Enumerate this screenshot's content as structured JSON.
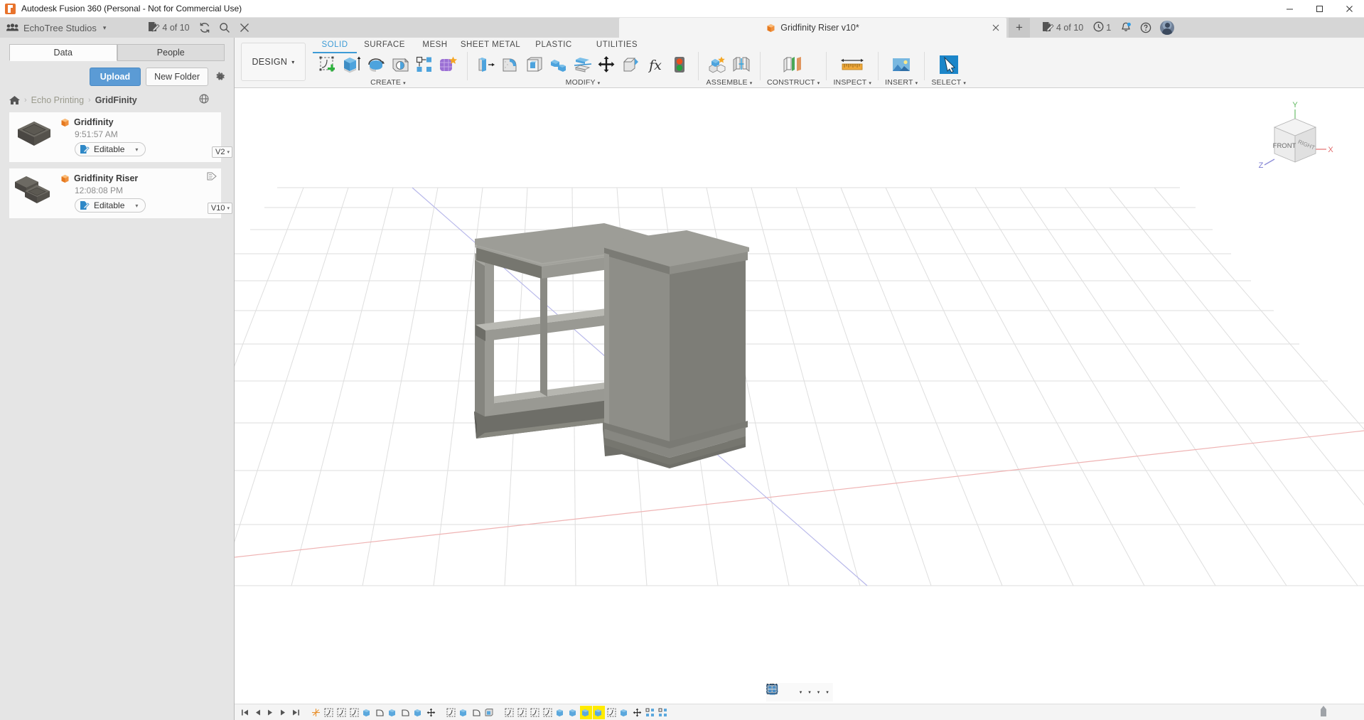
{
  "window": {
    "title": "Autodesk Fusion 360 (Personal - Not for Commercial Use)",
    "app_icon": "fusion-logo-icon",
    "minimize": "–",
    "maximize": "☐",
    "close": "✕"
  },
  "appbar": {
    "grid_icon": "app-grid-icon",
    "team_name": "EchoTree Studios",
    "team_caret": "▾",
    "jobs_icon": "job-status-icon",
    "jobs_count": "4 of 10",
    "refresh_icon": "refresh-icon",
    "search_icon": "search-icon",
    "close_icon": "close-panel-icon"
  },
  "doctab": {
    "cube_icon": "fusion-document-icon",
    "title": "Gridfinity Riser v10*",
    "close_icon": "close-tab-icon",
    "new_tab_icon": "+"
  },
  "topright": {
    "jobs_icon": "job-status-icon",
    "jobs_count": "4 of 10",
    "clock_icon": "recent-activity-icon",
    "clock_count": "1",
    "bell_icon": "notifications-icon",
    "help_icon": "help-icon",
    "avatar": "user-avatar"
  },
  "leftpanel": {
    "tabs": [
      {
        "label": "Data",
        "active": true
      },
      {
        "label": "People",
        "active": false
      }
    ],
    "upload_label": "Upload",
    "new_folder_label": "New Folder",
    "gear_icon": "settings-gear-icon",
    "breadcrumb": {
      "home_icon": "home-icon",
      "sep": "›",
      "items": [
        "Echo Printing",
        "GridFinity"
      ],
      "globe_icon": "globe-icon"
    },
    "files": [
      {
        "thumb": "gridfinity-bin-thumbnail",
        "cube_icon": "fusion-design-icon",
        "name": "Gridfinity",
        "time": "9:51:57 AM",
        "status_icon": "editable-pencil-icon",
        "status": "Editable",
        "status_caret": "▾",
        "version": "V2",
        "version_caret": "▾",
        "tagged": false
      },
      {
        "thumb": "gridfinity-riser-thumbnail",
        "cube_icon": "fusion-design-icon",
        "name": "Gridfinity Riser",
        "time": "12:08:08 PM",
        "status_icon": "editable-pencil-icon",
        "status": "Editable",
        "status_caret": "▾",
        "version": "V10",
        "version_caret": "▾",
        "tagged": true
      }
    ]
  },
  "ribbon": {
    "workspace_label": "DESIGN",
    "workspace_caret": "▾",
    "tabs": [
      {
        "label": "SOLID",
        "active": true
      },
      {
        "label": "SURFACE",
        "active": false
      },
      {
        "label": "MESH",
        "active": false
      },
      {
        "label": "SHEET METAL",
        "active": false
      },
      {
        "label": "PLASTIC",
        "active": false
      },
      {
        "label": "UTILITIES",
        "active": false
      }
    ],
    "groups": [
      {
        "label": "CREATE",
        "caret": "▾",
        "buttons": [
          "create-sketch-icon",
          "extrude-icon",
          "revolve-icon",
          "hole-icon",
          "rectangular-pattern-icon",
          "create-form-icon"
        ]
      },
      {
        "label": "MODIFY",
        "caret": "▾",
        "buttons": [
          "press-pull-icon",
          "fillet-icon",
          "shell-icon",
          "combine-icon",
          "split-body-icon",
          "move-copy-icon",
          "align-icon",
          "change-parameters-icon",
          "compute-all-icon"
        ]
      },
      {
        "label": "ASSEMBLE",
        "caret": "▾",
        "buttons": [
          "new-component-icon",
          "joint-icon"
        ]
      },
      {
        "label": "CONSTRUCT",
        "caret": "▾",
        "buttons": [
          "offset-plane-icon"
        ]
      },
      {
        "label": "INSPECT",
        "caret": "▾",
        "buttons": [
          "measure-icon"
        ]
      },
      {
        "label": "INSERT",
        "caret": "▾",
        "buttons": [
          "insert-mcmaster-icon"
        ]
      },
      {
        "label": "SELECT",
        "caret": "▾",
        "buttons": [
          "select-icon"
        ]
      }
    ]
  },
  "viewcube": {
    "front_label": "FRONT",
    "right_label": "RIGHT",
    "axis_x": "X",
    "axis_y": "Y",
    "axis_z": "Z",
    "axis_x_color": "#e88b8b",
    "axis_y_color": "#7fc77f",
    "axis_z_color": "#8f8fd8"
  },
  "navbar": {
    "buttons": [
      {
        "icon": "orbit-icon",
        "caret": "▾"
      },
      {
        "icon": "fit-view-icon",
        "caret": ""
      },
      {
        "icon": "pan-icon",
        "caret": ""
      },
      {
        "icon": "zoom-icon",
        "caret": ""
      },
      {
        "icon": "zoom-window-icon",
        "caret": "▾"
      },
      {
        "icon": "display-settings-icon",
        "caret": "▾"
      },
      {
        "icon": "grid-snaps-icon",
        "caret": "▾"
      },
      {
        "icon": "viewports-icon",
        "caret": "▾"
      }
    ]
  },
  "timeline": {
    "playback": [
      "jump-start-icon",
      "step-back-icon",
      "play-icon",
      "step-forward-icon",
      "jump-end-icon"
    ],
    "nodes": [
      {
        "icon": "origin-node",
        "selected": false
      },
      {
        "icon": "sketch-node",
        "selected": false
      },
      {
        "icon": "sketch-node",
        "selected": false
      },
      {
        "icon": "sketch-node",
        "selected": false
      },
      {
        "icon": "extrude-node",
        "selected": false
      },
      {
        "icon": "fillet-node",
        "selected": false
      },
      {
        "icon": "extrude-node",
        "selected": false
      },
      {
        "icon": "fillet-node",
        "selected": false
      },
      {
        "icon": "extrude-node",
        "selected": false
      },
      {
        "icon": "move-node",
        "selected": false
      },
      {
        "icon": "sketch-node",
        "selected": false
      },
      {
        "icon": "extrude-node",
        "selected": false
      },
      {
        "icon": "fillet-node",
        "selected": false
      },
      {
        "icon": "shell-node",
        "selected": false
      },
      {
        "icon": "sketch-node",
        "selected": false
      },
      {
        "icon": "sketch-node",
        "selected": false
      },
      {
        "icon": "sketch-node",
        "selected": false
      },
      {
        "icon": "sketch-node",
        "selected": false
      },
      {
        "icon": "extrude-node",
        "selected": false
      },
      {
        "icon": "extrude-node",
        "selected": false
      },
      {
        "icon": "extrude-node",
        "selected": true
      },
      {
        "icon": "extrude-node",
        "selected": true
      },
      {
        "icon": "sketch-node",
        "selected": false
      },
      {
        "icon": "extrude-node",
        "selected": false
      },
      {
        "icon": "move-node",
        "selected": false
      },
      {
        "icon": "pattern-node",
        "selected": false
      },
      {
        "icon": "pattern-node",
        "selected": false
      }
    ],
    "end_marker": "timeline-end-marker"
  },
  "colors": {
    "accent_blue": "#3d9bd6",
    "upload_blue": "#5b9bd5",
    "titlebar_bg": "#ffffff",
    "appbar_bg": "#d6d6d6",
    "panel_bg": "#e5e5e5",
    "ribbon_bg": "#f4f4f4",
    "canvas_bg": "#ffffff",
    "model_gray": "#8d8d87",
    "grid_line": "#dcdcdc"
  }
}
